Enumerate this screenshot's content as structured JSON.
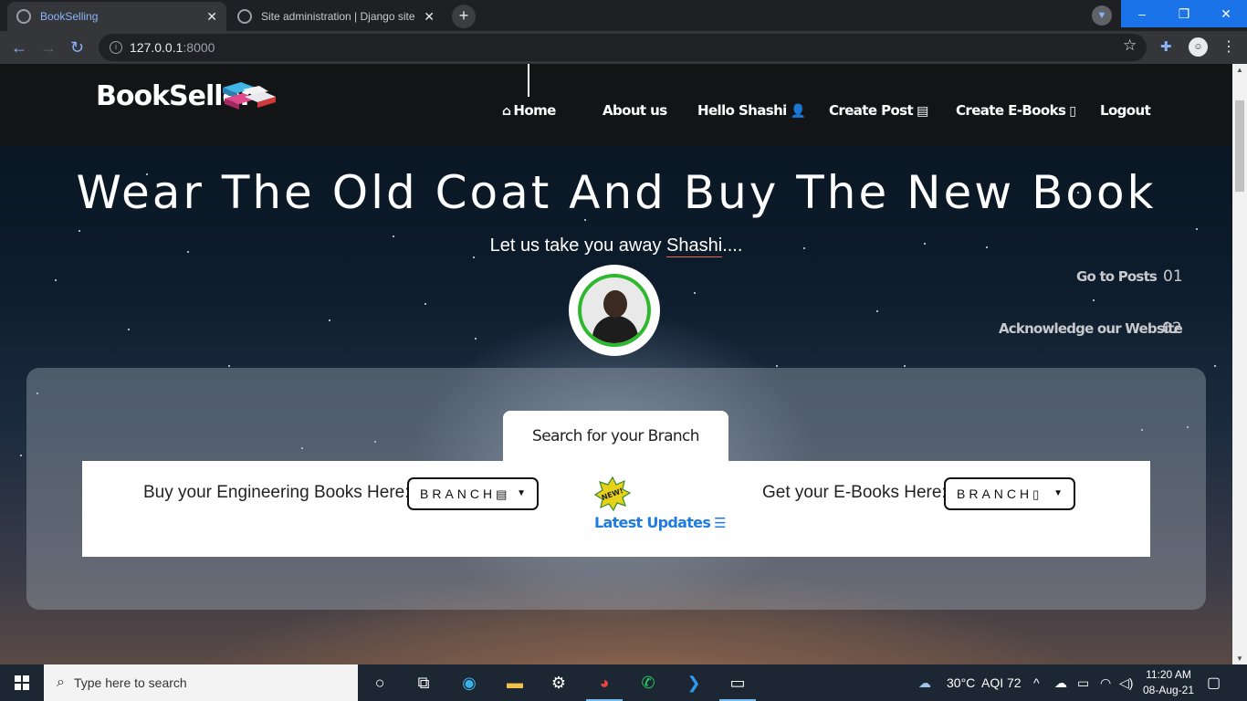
{
  "browser": {
    "tabs": [
      {
        "title": "BookSelling",
        "active": true
      },
      {
        "title": "Site administration | Django site",
        "active": false
      }
    ],
    "address": {
      "host": "127.0.0.1",
      "port": ":8000"
    }
  },
  "site": {
    "brand": "BookSeller",
    "nav": [
      {
        "label": "Home",
        "icon": "home-icon"
      },
      {
        "label": "About us"
      },
      {
        "label": "Hello Shashi",
        "icon": "user-icon"
      },
      {
        "label": "Create Post",
        "icon": "book-icon"
      },
      {
        "label": "Create E-Books",
        "icon": "file-icon"
      },
      {
        "label": "Logout"
      }
    ],
    "hero": {
      "title": "Wear The Old Coat And Buy The New Book",
      "subtitle_prefix": "Let us take you away ",
      "subtitle_name": "Shashi",
      "subtitle_suffix": "...."
    },
    "side_links": [
      {
        "label": "Go to Posts",
        "num": "01"
      },
      {
        "label": "Acknowledge our Website",
        "num": "02"
      }
    ],
    "search": {
      "tab_label": "Search for your Branch",
      "left_label": "Buy your Engineering Books Here:",
      "left_dropdown": "BRANCH",
      "right_label": "Get your E-Books Here:",
      "right_dropdown": "BRANCH",
      "updates_label": "Latest Updates",
      "badge_text": "NEW!"
    }
  },
  "taskbar": {
    "search_placeholder": "Type here to search",
    "weather": "30°C",
    "aqi": "AQI 72",
    "time": "11:20 AM",
    "date": "08-Aug-21"
  },
  "colors": {
    "accent_blue": "#1e7be0",
    "avatar_ring": "#2eb82e",
    "underline": "#e86a4a"
  }
}
